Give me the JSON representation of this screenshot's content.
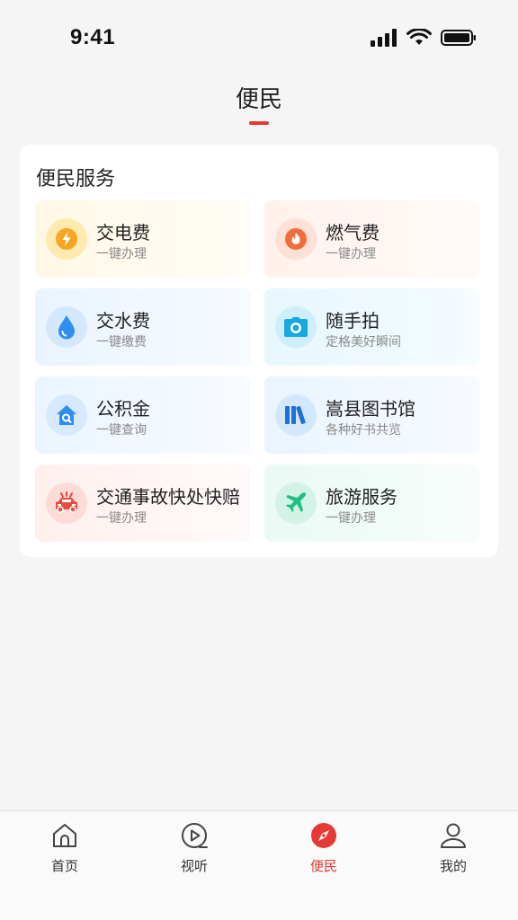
{
  "status_bar": {
    "time": "9:41"
  },
  "header": {
    "title": "便民"
  },
  "services": {
    "title": "便民服务",
    "items": [
      {
        "label": "交电费",
        "sub": "一键办理",
        "icon": "lightning-icon"
      },
      {
        "label": "燃气费",
        "sub": "一键办理",
        "icon": "flame-icon"
      },
      {
        "label": "交水费",
        "sub": "一键缴费",
        "icon": "water-drop-icon"
      },
      {
        "label": "随手拍",
        "sub": "定格美好瞬间",
        "icon": "camera-icon"
      },
      {
        "label": "公积金",
        "sub": "一键查询",
        "icon": "house-search-icon"
      },
      {
        "label": "嵩县图书馆",
        "sub": "各种好书共览",
        "icon": "books-icon"
      },
      {
        "label": "交通事故快处快赔",
        "sub": "一键办理",
        "icon": "car-accident-icon"
      },
      {
        "label": "旅游服务",
        "sub": "一键办理",
        "icon": "airplane-icon"
      }
    ]
  },
  "tabbar": {
    "tabs": [
      {
        "label": "首页",
        "icon": "home-icon"
      },
      {
        "label": "视听",
        "icon": "play-icon"
      },
      {
        "label": "便民",
        "icon": "compass-icon"
      },
      {
        "label": "我的",
        "icon": "person-icon"
      }
    ],
    "active_color": "#e53935"
  }
}
